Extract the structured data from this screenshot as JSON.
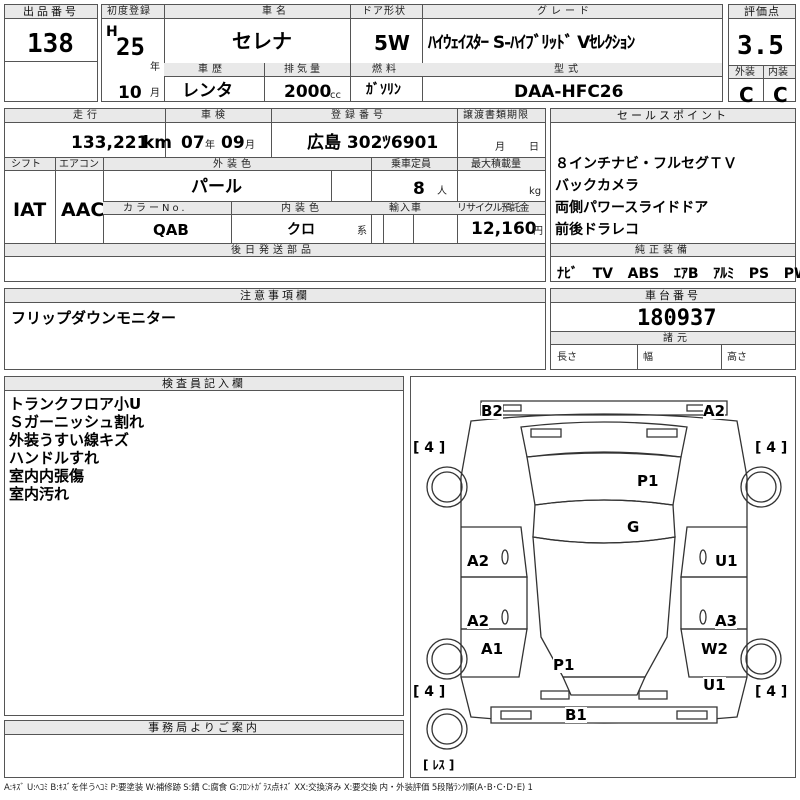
{
  "lot": {
    "label": "出品番号",
    "value": "138"
  },
  "first_reg": {
    "label": "初度登録",
    "era": "H",
    "year": "25",
    "year_unit": "年",
    "month": "10",
    "month_unit": "月"
  },
  "car_name": {
    "label": "車名",
    "value": "セレナ"
  },
  "door": {
    "label": "ドア形状",
    "value": "5W"
  },
  "grade": {
    "label": "グレード",
    "value": "ﾊｲｳｪｲｽﾀｰ S-ﾊｲﾌﾞﾘｯﾄﾞ Vｾﾚｸｼｮﾝ"
  },
  "score": {
    "label": "評価点",
    "value": "3.5",
    "ext_label": "外装",
    "int_label": "内装",
    "ext": "C",
    "int": "C"
  },
  "history": {
    "label": "車歴",
    "value": "レンタ"
  },
  "displacement": {
    "label": "排気量",
    "value": "2000",
    "unit": "cc"
  },
  "fuel": {
    "label": "燃料",
    "value": "ｶﾞｿﾘﾝ"
  },
  "model_code": {
    "label": "型式",
    "value": "DAA-HFC26"
  },
  "mileage": {
    "label": "走行",
    "value": "133,221",
    "unit": "km"
  },
  "inspection": {
    "label": "車検",
    "year": "07",
    "year_unit": "年",
    "month": "09",
    "month_unit": "月"
  },
  "reg_no": {
    "label": "登録番号",
    "value": "広島 302ﾂ6901"
  },
  "transfer": {
    "label": "譲渡書類期限",
    "month_unit": "月",
    "day_unit": "日"
  },
  "shift": {
    "label": "シフト",
    "value": "IAT"
  },
  "aircon": {
    "label": "エアコン",
    "value": "AAC"
  },
  "ext_color": {
    "label": "外装色",
    "value": "パール"
  },
  "capacity": {
    "label": "乗車定員",
    "value": "8",
    "unit": "人"
  },
  "max_load": {
    "label": "最大積載量",
    "unit": "kg"
  },
  "color_no": {
    "label": "カラーNo.",
    "value": "QAB"
  },
  "int_color": {
    "label": "内装色",
    "value": "クロ",
    "unit": "系"
  },
  "import": {
    "label": "輸入車"
  },
  "recycle": {
    "label": "リサイクル預託金",
    "value": "12,160",
    "unit": "円"
  },
  "later_parts": {
    "label": "後日発送部品"
  },
  "sales_points": {
    "label": "セールスポイント",
    "items": [
      "８インチナビ・フルセグＴＶ",
      "バックカメラ",
      "両側パワースライドドア",
      "前後ドラレコ"
    ]
  },
  "equipment": {
    "label": "純正装備",
    "items": [
      "ﾅﾋﾞ",
      "TV",
      "ABS",
      "ｴｱB",
      "ｱﾙﾐ",
      "PS",
      "PW"
    ]
  },
  "notes": {
    "label": "注意事項欄",
    "value": "フリップダウンモニター"
  },
  "chassis": {
    "label": "車台番号",
    "value": "180937"
  },
  "specs": {
    "label": "諸元",
    "length": "長さ",
    "width": "幅",
    "height": "高さ"
  },
  "inspector": {
    "label": "検査員記入欄",
    "items": [
      "トランクフロア小U",
      "Ｓガーニッシュ割れ",
      "外装うすい線キズ",
      "ハンドルすれ",
      "室内内張傷",
      "室内汚れ"
    ]
  },
  "office": {
    "label": "事務局よりご案内"
  },
  "diagram": {
    "marks": {
      "b2": "B2",
      "a2_top": "A2",
      "p1_top": "P1",
      "g": "G",
      "a2_left1": "A2",
      "a2_left2": "A2",
      "a1": "A1",
      "p1_bottom": "P1",
      "u1_right": "U1",
      "a3": "A3",
      "w2": "W2",
      "u1_bottom": "U1",
      "b1": "B1"
    },
    "tires": {
      "fl": "[ 4 ]",
      "fr": "[ 4 ]",
      "rl": "[ 4 ]",
      "rr": "[ 4 ]",
      "spare": "[ ﾚｽ ]"
    }
  },
  "legend": "A:ｷｽﾞ U:ﾍｺﾐ B:ｷｽﾞを伴うﾍｺﾐ P:要塗装 W:補修跡 S:錆 C:腐食 G:ﾌﾛﾝﾄｶﾞﾗｽ点ｷｽﾞ XX:交換済み X:要交換 内・外装評価 5段階ﾗﾝｸ順(A･B･C･D･E) 1"
}
